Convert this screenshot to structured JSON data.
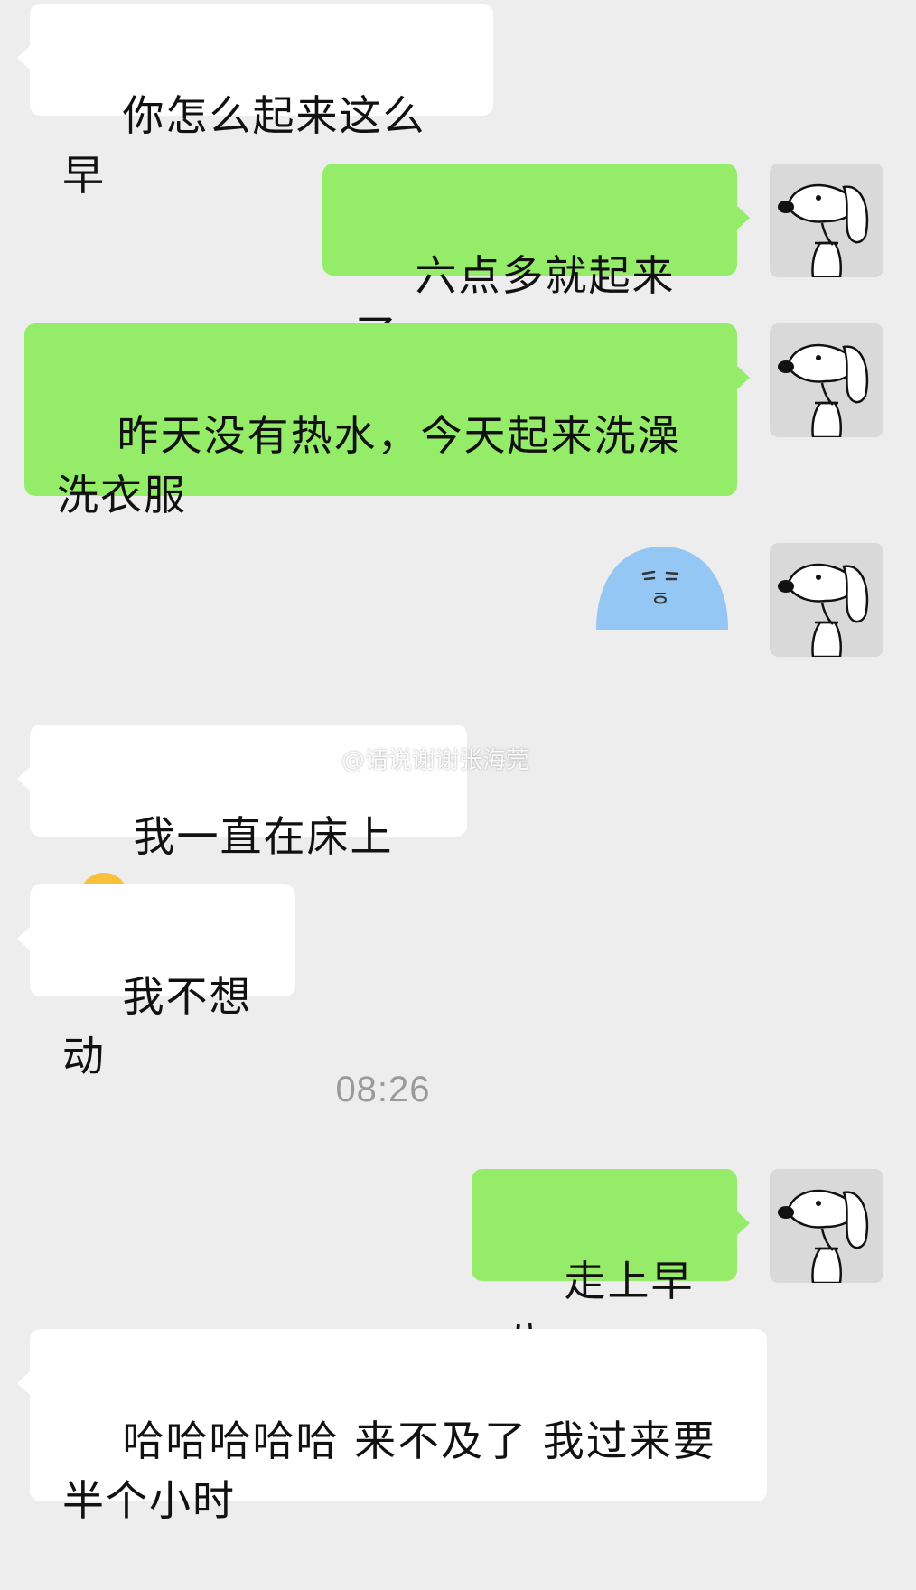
{
  "messages": [
    {
      "side": "in",
      "text": "你怎么起来这么早"
    },
    {
      "side": "out",
      "text": "六点多就起来了"
    },
    {
      "side": "out",
      "text": "昨天没有热水，今天起来洗澡洗衣服"
    },
    {
      "side": "out",
      "type": "sticker",
      "sticker": "blue-blob-face-sticker"
    },
    {
      "side": "in",
      "text": "我一直在床上",
      "emoji": "face-with-hand-over-eye-emoji"
    },
    {
      "side": "in",
      "text": "我不想动"
    },
    {
      "side": "out",
      "text": "走上早八"
    },
    {
      "side": "in",
      "text": "哈哈哈哈哈 来不及了 我过来要半个小时"
    }
  ],
  "timestamp": "08:26",
  "watermark": "@请说谢谢张海莞",
  "avatar": "snoopy-avatar",
  "colors": {
    "background": "#ededed",
    "incoming_bubble": "#ffffff",
    "outgoing_bubble": "#95ec69",
    "timestamp": "#9a9a9a"
  }
}
